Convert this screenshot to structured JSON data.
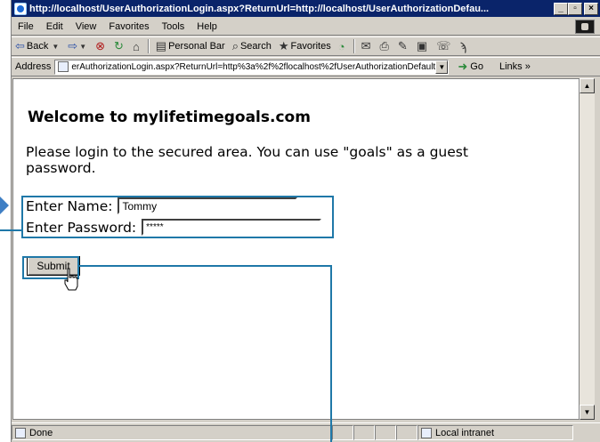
{
  "window": {
    "title": "http://localhost/UserAuthorizationLogin.aspx?ReturnUrl=http://localhost/UserAuthorizationDefau...",
    "controls": [
      "_",
      "▫",
      "×"
    ]
  },
  "menu": [
    "File",
    "Edit",
    "View",
    "Favorites",
    "Tools",
    "Help"
  ],
  "toolbar": {
    "back": "Back",
    "personal_bar": "Personal Bar",
    "search": "Search",
    "favorites": "Favorites"
  },
  "address": {
    "label": "Address",
    "url": "erAuthorizationLogin.aspx?ReturnUrl=http%3a%2f%2flocalhost%2fUserAuthorizationDefault.aspx",
    "go": "Go",
    "links": "Links »"
  },
  "page": {
    "heading": "Welcome to mylifetimegoals.com",
    "intro": "Please login to the secured area. You can use \"goals\" as a guest password.",
    "name_label": "Enter Name:",
    "name_value": "Tommy",
    "password_label": "Enter Password:",
    "password_value": "*****",
    "submit_label": "Submit"
  },
  "status": {
    "text": "Done",
    "zone": "Local intranet"
  }
}
